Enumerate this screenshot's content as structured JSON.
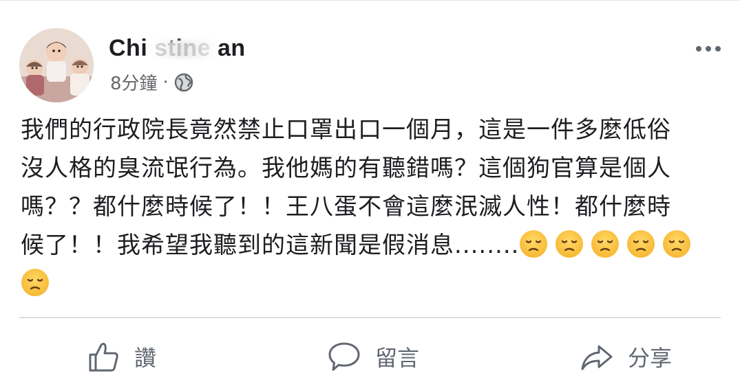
{
  "post": {
    "author": "Chi stine  an",
    "time": "8分鐘",
    "dot": "·",
    "text_lines": [
      "我們的行政院長竟然禁止口罩出口一個月，這是一件多麼低俗",
      "沒人格的臭流氓行為。我他媽的有聽錯嗎？這個狗官算是個人",
      "嗎？？都什麼時候了！！王八蛋不會這麼泯滅人性！都什麼時",
      "候了！！我希望我聽到的這新聞是假消息........"
    ],
    "emojis": [
      "disappointed-face",
      "disappointed-face",
      "disappointed-face",
      "disappointed-face",
      "disappointed-face",
      "disappointed-face"
    ]
  },
  "actions": {
    "like_label": "讚",
    "comment_label": "留言",
    "share_label": "分享"
  },
  "icons": {
    "more": "more-horizontal-icon",
    "privacy": "globe-icon",
    "like": "thumbs-up-icon",
    "comment": "speech-bubble-icon",
    "share": "share-arrow-icon"
  },
  "colors": {
    "text": "#1c1e21",
    "secondary": "#65676b",
    "divider": "#dadde1",
    "emoji_face": "#f7b733"
  }
}
